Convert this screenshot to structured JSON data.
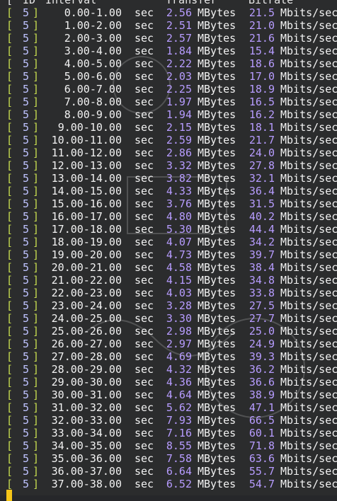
{
  "header": {
    "id": "ID",
    "interval": "Interval",
    "transfer": "Transfer",
    "bitrate": "Bitrate"
  },
  "units": {
    "sec": "sec",
    "transfer": "MBytes",
    "bitrate": "Mbits/sec"
  },
  "rows": [
    {
      "id": "5",
      "interval": "0.00-1.00",
      "transfer": "2.56",
      "bitrate": "21.5"
    },
    {
      "id": "5",
      "interval": "1.00-2.00",
      "transfer": "2.51",
      "bitrate": "21.0"
    },
    {
      "id": "5",
      "interval": "2.00-3.00",
      "transfer": "2.57",
      "bitrate": "21.6"
    },
    {
      "id": "5",
      "interval": "3.00-4.00",
      "transfer": "1.84",
      "bitrate": "15.4"
    },
    {
      "id": "5",
      "interval": "4.00-5.00",
      "transfer": "2.22",
      "bitrate": "18.6"
    },
    {
      "id": "5",
      "interval": "5.00-6.00",
      "transfer": "2.03",
      "bitrate": "17.0"
    },
    {
      "id": "5",
      "interval": "6.00-7.00",
      "transfer": "2.25",
      "bitrate": "18.9"
    },
    {
      "id": "5",
      "interval": "7.00-8.00",
      "transfer": "1.97",
      "bitrate": "16.5"
    },
    {
      "id": "5",
      "interval": "8.00-9.00",
      "transfer": "1.94",
      "bitrate": "16.2"
    },
    {
      "id": "5",
      "interval": "9.00-10.00",
      "transfer": "2.15",
      "bitrate": "18.1"
    },
    {
      "id": "5",
      "interval": "10.00-11.00",
      "transfer": "2.59",
      "bitrate": "21.7"
    },
    {
      "id": "5",
      "interval": "11.00-12.00",
      "transfer": "2.86",
      "bitrate": "24.0"
    },
    {
      "id": "5",
      "interval": "12.00-13.00",
      "transfer": "3.32",
      "bitrate": "27.8"
    },
    {
      "id": "5",
      "interval": "13.00-14.00",
      "transfer": "3.82",
      "bitrate": "32.1"
    },
    {
      "id": "5",
      "interval": "14.00-15.00",
      "transfer": "4.33",
      "bitrate": "36.4"
    },
    {
      "id": "5",
      "interval": "15.00-16.00",
      "transfer": "3.76",
      "bitrate": "31.5"
    },
    {
      "id": "5",
      "interval": "16.00-17.00",
      "transfer": "4.80",
      "bitrate": "40.2"
    },
    {
      "id": "5",
      "interval": "17.00-18.00",
      "transfer": "5.30",
      "bitrate": "44.4"
    },
    {
      "id": "5",
      "interval": "18.00-19.00",
      "transfer": "4.07",
      "bitrate": "34.2"
    },
    {
      "id": "5",
      "interval": "19.00-20.00",
      "transfer": "4.73",
      "bitrate": "39.7"
    },
    {
      "id": "5",
      "interval": "20.00-21.00",
      "transfer": "4.58",
      "bitrate": "38.4"
    },
    {
      "id": "5",
      "interval": "21.00-22.00",
      "transfer": "4.15",
      "bitrate": "34.8"
    },
    {
      "id": "5",
      "interval": "22.00-23.00",
      "transfer": "4.03",
      "bitrate": "33.8"
    },
    {
      "id": "5",
      "interval": "23.00-24.00",
      "transfer": "3.28",
      "bitrate": "27.5"
    },
    {
      "id": "5",
      "interval": "24.00-25.00",
      "transfer": "3.30",
      "bitrate": "27.7"
    },
    {
      "id": "5",
      "interval": "25.00-26.00",
      "transfer": "2.98",
      "bitrate": "25.0"
    },
    {
      "id": "5",
      "interval": "26.00-27.00",
      "transfer": "2.97",
      "bitrate": "24.9"
    },
    {
      "id": "5",
      "interval": "27.00-28.00",
      "transfer": "4.69",
      "bitrate": "39.3"
    },
    {
      "id": "5",
      "interval": "28.00-29.00",
      "transfer": "4.32",
      "bitrate": "36.2"
    },
    {
      "id": "5",
      "interval": "29.00-30.00",
      "transfer": "4.36",
      "bitrate": "36.6"
    },
    {
      "id": "5",
      "interval": "30.00-31.00",
      "transfer": "4.64",
      "bitrate": "38.9"
    },
    {
      "id": "5",
      "interval": "31.00-32.00",
      "transfer": "5.62",
      "bitrate": "47.1"
    },
    {
      "id": "5",
      "interval": "32.00-33.00",
      "transfer": "7.93",
      "bitrate": "66.5"
    },
    {
      "id": "5",
      "interval": "33.00-34.00",
      "transfer": "7.16",
      "bitrate": "60.1"
    },
    {
      "id": "5",
      "interval": "34.00-35.00",
      "transfer": "8.55",
      "bitrate": "71.8"
    },
    {
      "id": "5",
      "interval": "35.00-36.00",
      "transfer": "7.58",
      "bitrate": "63.6"
    },
    {
      "id": "5",
      "interval": "36.00-37.00",
      "transfer": "6.64",
      "bitrate": "55.7"
    },
    {
      "id": "5",
      "interval": "37.00-38.00",
      "transfer": "6.52",
      "bitrate": "54.7"
    }
  ]
}
